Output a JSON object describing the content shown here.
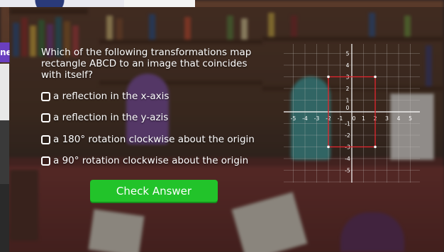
{
  "question": {
    "text": "Which of the following transformations map rectangle ABCD to an image that coincides with itself?"
  },
  "options": [
    {
      "label": "a reflection in the x-axis"
    },
    {
      "label": "a reflection in the y-azis"
    },
    {
      "label": "a 180° rotation clockwise about the origin"
    },
    {
      "label": "a 90° rotation clockwise about the origin"
    }
  ],
  "check_button": {
    "label": "Check Answer"
  },
  "edge_tab": {
    "label": "ne"
  },
  "graph": {
    "x_ticks": [
      "-5",
      "-4",
      "-3",
      "-2",
      "-1",
      "0",
      "1",
      "2",
      "3",
      "4",
      "5"
    ],
    "y_ticks": [
      "5",
      "4",
      "3",
      "2",
      "1",
      "0",
      "-1",
      "-2",
      "-3",
      "-4",
      "-5"
    ],
    "rectangle_x": [
      -2,
      2
    ],
    "rectangle_y": [
      -3,
      3
    ],
    "rectangle_color": "#e3262f"
  },
  "colors": {
    "button": "#22c32a",
    "text": "#ffffff",
    "grid": "#c9c3c0"
  }
}
